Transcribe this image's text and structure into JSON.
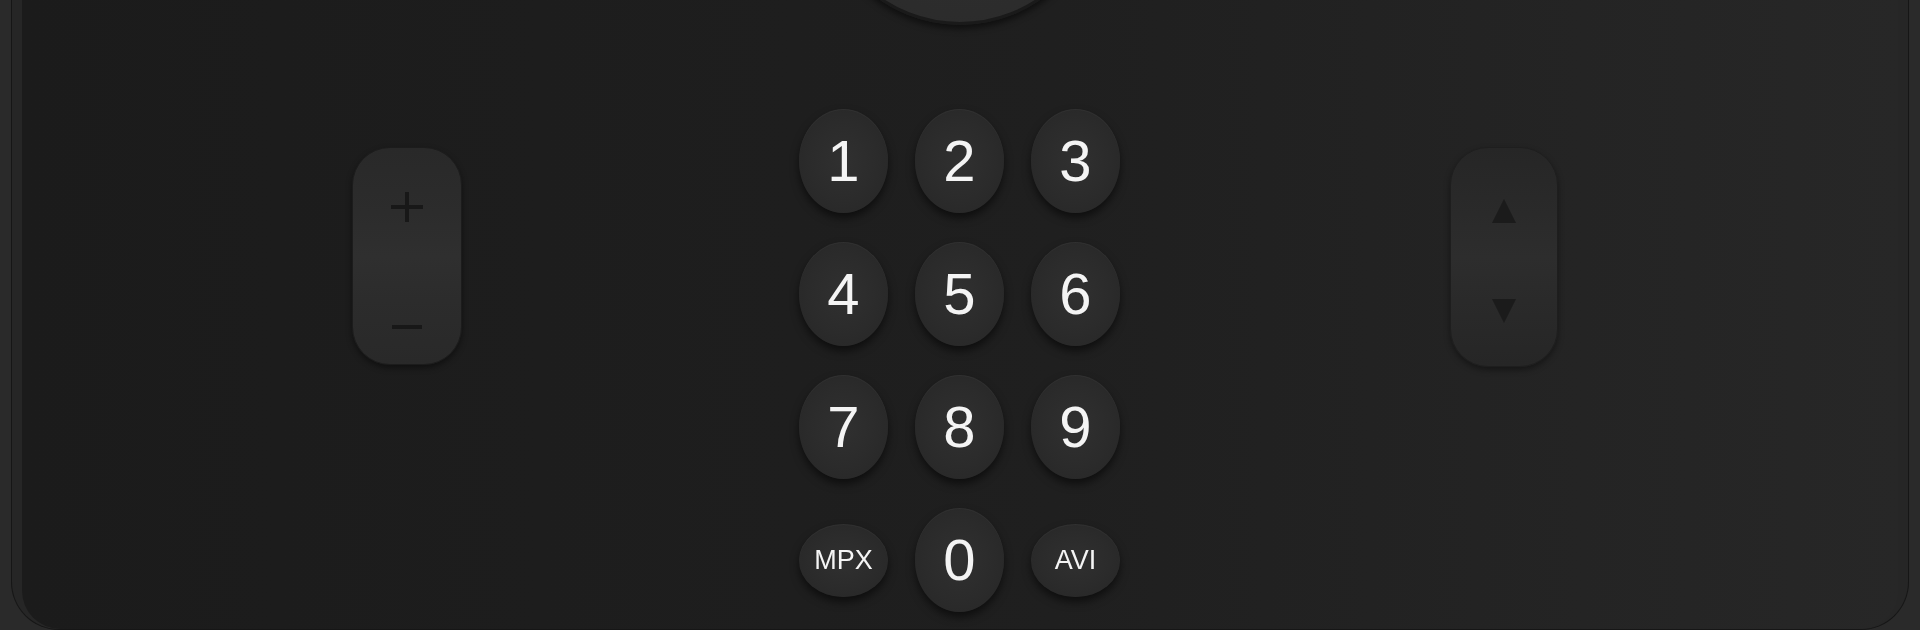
{
  "keypad": {
    "keys": [
      {
        "label": "1",
        "kind": "digit"
      },
      {
        "label": "2",
        "kind": "digit"
      },
      {
        "label": "3",
        "kind": "digit"
      },
      {
        "label": "4",
        "kind": "digit"
      },
      {
        "label": "5",
        "kind": "digit"
      },
      {
        "label": "6",
        "kind": "digit"
      },
      {
        "label": "7",
        "kind": "digit"
      },
      {
        "label": "8",
        "kind": "digit"
      },
      {
        "label": "9",
        "kind": "digit"
      },
      {
        "label": "MPX",
        "kind": "function"
      },
      {
        "label": "0",
        "kind": "digit"
      },
      {
        "label": "AVI",
        "kind": "function"
      }
    ]
  }
}
